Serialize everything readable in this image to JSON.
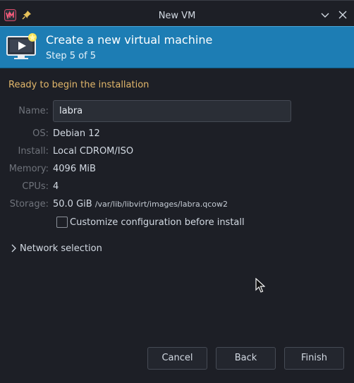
{
  "window": {
    "title": "New VM"
  },
  "header": {
    "title": "Create a new virtual machine",
    "step": "Step 5 of 5"
  },
  "summary": {
    "heading": "Ready to begin the installation",
    "name_label": "Name:",
    "name_value": "labra",
    "os_label": "OS:",
    "os_value": "Debian 12",
    "install_label": "Install:",
    "install_value": "Local CDROM/ISO",
    "memory_label": "Memory:",
    "memory_value": "4096 MiB",
    "cpus_label": "CPUs:",
    "cpus_value": "4",
    "storage_label": "Storage:",
    "storage_size": "50.0 GiB",
    "storage_path": "/var/lib/libvirt/images/labra.qcow2",
    "customize_label": "Customize configuration before install",
    "customize_checked": false
  },
  "network": {
    "label": "Network selection"
  },
  "buttons": {
    "cancel": "Cancel",
    "back": "Back",
    "finish": "Finish"
  },
  "colors": {
    "header_bg": "#1d7db4",
    "heading_accent": "#e2b76b",
    "window_bg": "#1d1f26"
  }
}
